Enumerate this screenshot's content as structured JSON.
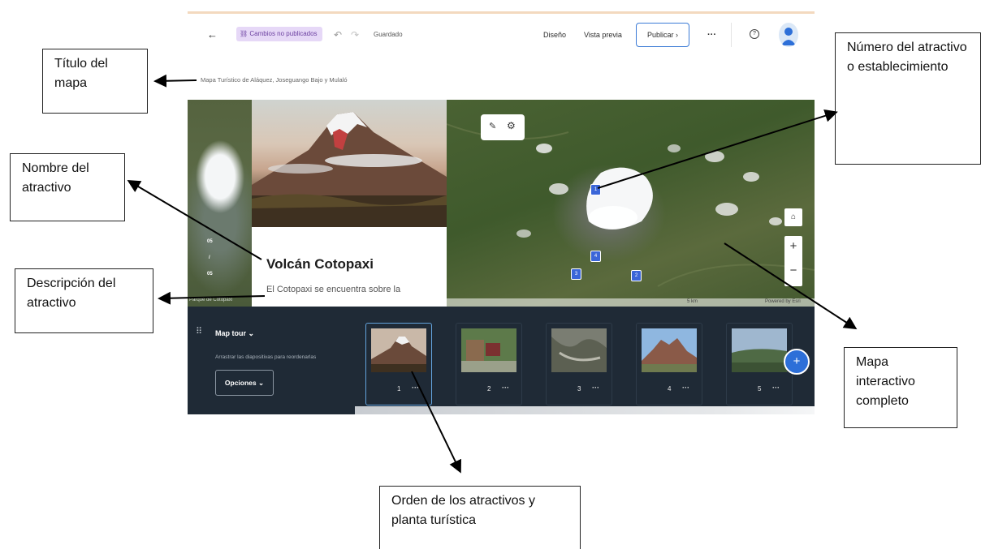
{
  "toolbar": {
    "back_icon": "←",
    "unpublished_label": "Cambios no publicados",
    "undo_icon": "↶",
    "redo_icon": "↷",
    "saved_label": "Guardado",
    "design_label": "Diseño",
    "preview_label": "Vista previa",
    "publish_label": "Publicar ›",
    "more_label": "···",
    "help_icon": "?"
  },
  "map": {
    "title": "Mapa Turístico de Aláquez, Joseguango Bajo y Mulaló",
    "left_pager": {
      "current": "05",
      "sep": "/",
      "total": "05"
    },
    "left_attribution": "Parque de Cotopaxi",
    "scale_label": "5 km",
    "powered_by": "Powered by Esri",
    "zoom_in": "+",
    "zoom_out": "−",
    "home_icon": "⌂",
    "markers": [
      "1",
      "4",
      "3",
      "2"
    ]
  },
  "attraction": {
    "name": "Volcán Cotopaxi",
    "description": "El Cotopaxi se encuentra sobre la"
  },
  "tray": {
    "title": "Map tour",
    "title_chevron": "⌄",
    "hint": "Arrastrar las diapositivas para reordenarlas",
    "options_label": "Opciones ⌄",
    "add_label": "+",
    "slides": [
      {
        "num": "1",
        "more": "···"
      },
      {
        "num": "2",
        "more": "···"
      },
      {
        "num": "3",
        "more": "···"
      },
      {
        "num": "4",
        "more": "···"
      },
      {
        "num": "5",
        "more": "···"
      }
    ]
  },
  "callouts": {
    "map_title": "Título del mapa",
    "attraction_number": "Número del atractivo o establecimiento",
    "attraction_name": "Nombre del atractivo",
    "attraction_description": "Descripción del atractivo",
    "interactive_map": "Mapa interactivo completo",
    "order": "Orden de los atractivos y planta turística"
  },
  "colors": {
    "accent": "#2d6fd8",
    "badge_bg": "#e6d8f7",
    "badge_text": "#6b3fa0",
    "tray_bg": "#1f2a36",
    "marker": "#3b66d8"
  }
}
